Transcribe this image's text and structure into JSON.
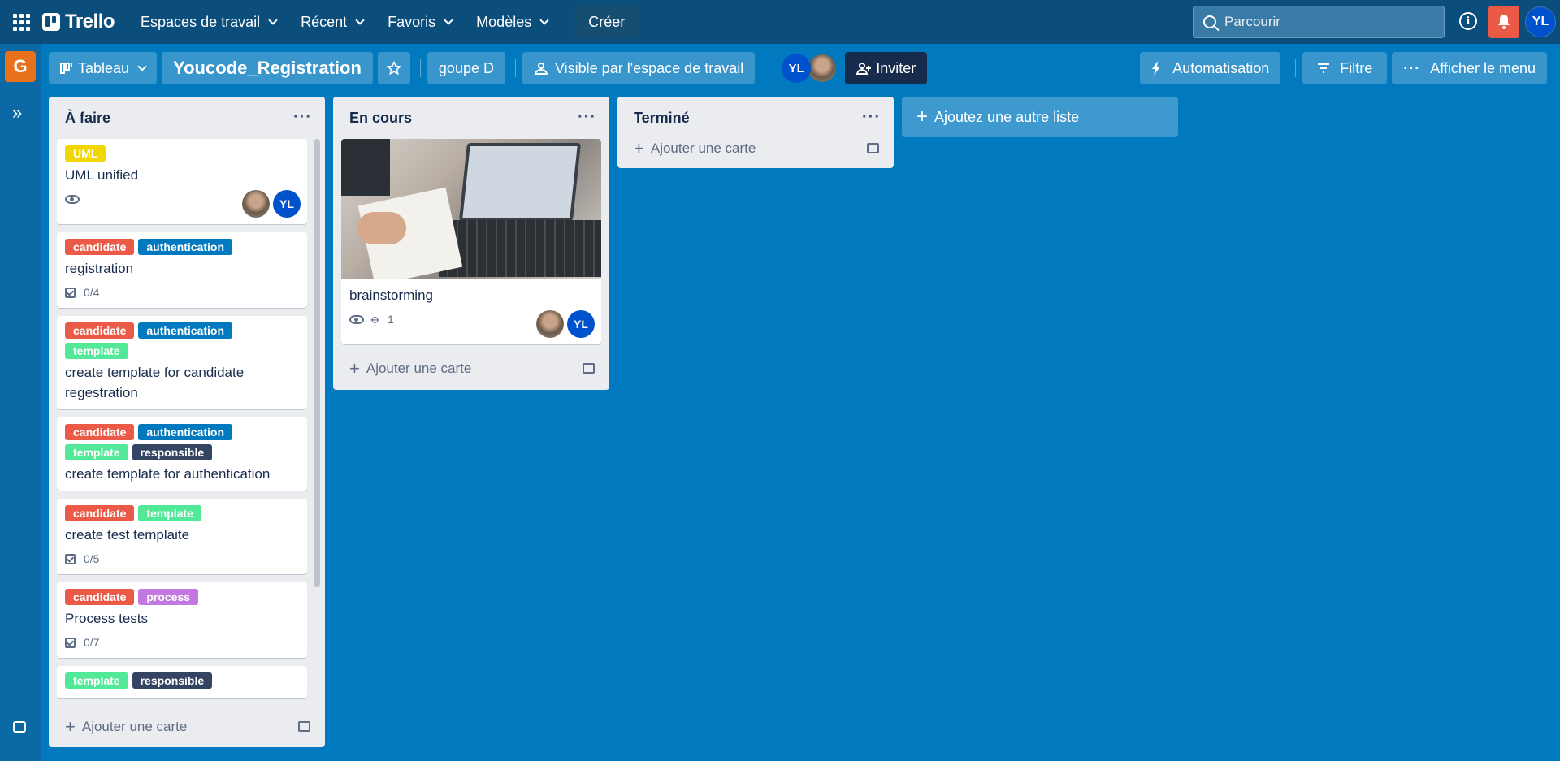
{
  "topnav": {
    "brand": "Trello",
    "menus": [
      "Espaces de travail",
      "Récent",
      "Favoris",
      "Modèles"
    ],
    "create_label": "Créer",
    "search_placeholder": "Parcourir",
    "avatar_initials": "YL"
  },
  "sidebar": {
    "workspace_letter": "G"
  },
  "board": {
    "view_label": "Tableau",
    "title": "Youcode_Registration",
    "workspace": "goupe D",
    "visibility": "Visible par l'espace de travail",
    "member_initials": "YL",
    "invite_label": "Inviter",
    "automation_label": "Automatisation",
    "filter_label": "Filtre",
    "menu_label": "Afficher le menu",
    "add_list_label": "Ajoutez une autre liste",
    "add_card_label": "Ajouter une carte"
  },
  "label_colors": {
    "UML": "#f2d600",
    "candidate": "#eb5a46",
    "authentication": "#0079bf",
    "template": "#51e898",
    "responsible": "#344563",
    "process": "#c377e0"
  },
  "lists": [
    {
      "title": "À faire",
      "cards": [
        {
          "labels": [
            "UML"
          ],
          "title": "UML unified",
          "watch": true,
          "members": [
            "photo",
            "YL"
          ]
        },
        {
          "labels": [
            "candidate",
            "authentication"
          ],
          "title": "registration",
          "checklist": "0/4"
        },
        {
          "labels": [
            "candidate",
            "authentication",
            "template"
          ],
          "title": "create template for candidate regestration"
        },
        {
          "labels": [
            "candidate",
            "authentication",
            "template",
            "responsible"
          ],
          "title": "create template for authentication"
        },
        {
          "labels": [
            "candidate",
            "template"
          ],
          "title": "create test templaite",
          "checklist": "0/5"
        },
        {
          "labels": [
            "candidate",
            "process"
          ],
          "title": "Process tests",
          "checklist": "0/7"
        },
        {
          "labels": [
            "template",
            "responsible"
          ],
          "title": ""
        }
      ]
    },
    {
      "title": "En cours",
      "cards": [
        {
          "cover": true,
          "labels": [],
          "title": "brainstorming",
          "watch": true,
          "attachments": "1",
          "members": [
            "photo",
            "YL"
          ]
        }
      ]
    },
    {
      "title": "Terminé",
      "cards": []
    }
  ]
}
